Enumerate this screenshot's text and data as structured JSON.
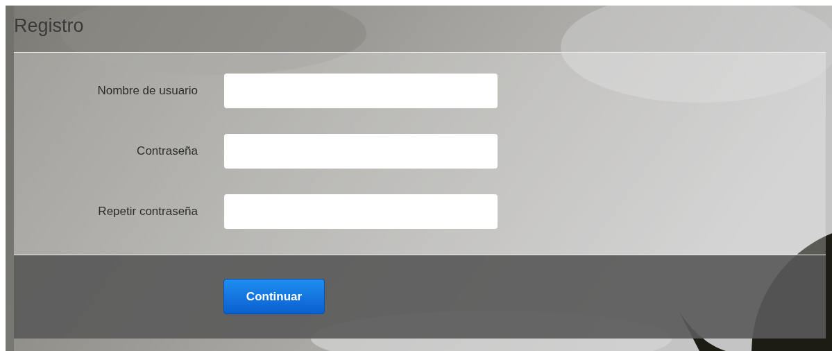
{
  "title": "Registro",
  "fields": [
    {
      "label": "Nombre de usuario"
    },
    {
      "label": "Contraseña"
    },
    {
      "label": "Repetir contraseña"
    }
  ],
  "submit": {
    "label": "Continuar"
  }
}
